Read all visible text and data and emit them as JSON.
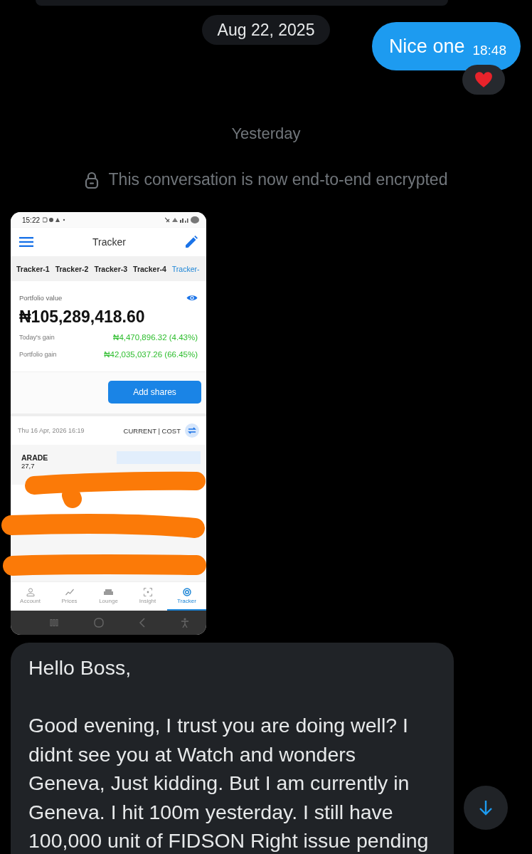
{
  "date_separator": "Aug 22, 2025",
  "outgoing_message": {
    "text": "Nice one",
    "time": "18:48"
  },
  "day_separator": "Yesterday",
  "encryption_notice": "This conversation is now end-to-end encrypted",
  "image_message": {
    "status_bar": {
      "time": "15:22"
    },
    "app_bar": {
      "title": "Tracker"
    },
    "tabs": [
      {
        "label": "Tracker-1",
        "selected": false
      },
      {
        "label": "Tracker-2",
        "selected": false
      },
      {
        "label": "Tracker-3",
        "selected": false
      },
      {
        "label": "Tracker-4",
        "selected": false
      },
      {
        "label": "Tracker-",
        "selected": true
      }
    ],
    "portfolio": {
      "label": "Portfolio value",
      "value": "₦105,289,418.60",
      "rows": [
        {
          "label": "Today's gain",
          "value": "₦4,470,896.32 (4.43%)"
        },
        {
          "label": "Portfolio gain",
          "value": "₦42,035,037.26 (66.45%)"
        }
      ]
    },
    "add_button": "Add shares",
    "timestamp": "Thu 16 Apr, 2026 16:19",
    "toggle_label": "CURRENT | COST",
    "holding": {
      "name": "ARADE",
      "quantity": "27,7"
    },
    "nav": [
      {
        "label": "Account",
        "selected": false,
        "kind": "person"
      },
      {
        "label": "Prices",
        "selected": false,
        "kind": "chart"
      },
      {
        "label": "Lounge",
        "selected": false,
        "kind": "sofa"
      },
      {
        "label": "Insight",
        "selected": false,
        "kind": "focus"
      },
      {
        "label": "Tracker",
        "selected": true,
        "kind": "tracker"
      }
    ]
  },
  "incoming_message": {
    "greeting": "Hello Boss,",
    "body": "Good evening, I trust you are doing well? I didnt see you at Watch and wonders Geneva, Just kidding. But I am currently in Geneva. I hit 100m yesterday. I still have 100,000 unit of FIDSON Right issue pending"
  }
}
